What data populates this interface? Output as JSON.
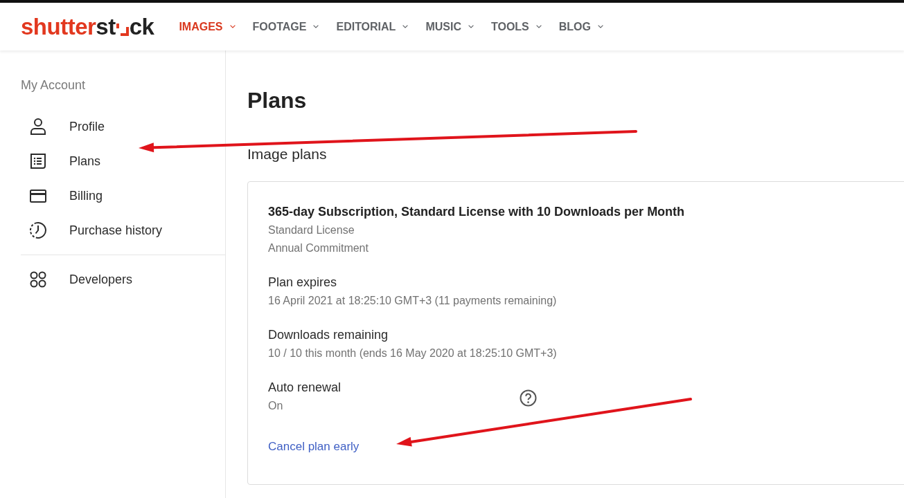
{
  "header": {
    "logo": [
      {
        "kind": "text",
        "text": "shutter",
        "color": "#e2381f"
      },
      {
        "kind": "text",
        "text": "st",
        "color": "#222222"
      },
      {
        "kind": "mark",
        "color": "#e2381f"
      },
      {
        "kind": "text",
        "text": "ck",
        "color": "#222222"
      }
    ],
    "nav": [
      {
        "label": "IMAGES",
        "selected": true
      },
      {
        "label": "FOOTAGE",
        "selected": false
      },
      {
        "label": "EDITORIAL",
        "selected": false
      },
      {
        "label": "MUSIC",
        "selected": false
      },
      {
        "label": "TOOLS",
        "selected": false
      },
      {
        "label": "BLOG",
        "selected": false
      }
    ]
  },
  "sidebar": {
    "heading": "My Account",
    "sections": [
      {
        "items": [
          {
            "label": "Profile"
          },
          {
            "label": "Plans"
          },
          {
            "label": "Billing"
          },
          {
            "label": "Purchase history"
          }
        ]
      },
      {
        "items": [
          {
            "label": "Developers"
          }
        ]
      }
    ]
  },
  "main": {
    "title": "Plans",
    "section_title": "Image plans",
    "plan": {
      "name": "365-day Subscription, Standard License with 10 Downloads per Month",
      "details": [
        "Standard License",
        "Annual Commitment"
      ],
      "fields": [
        {
          "label": "Plan expires",
          "value": "16 April 2021 at 18:25:10 GMT+3 (11 payments remaining)",
          "help": false
        },
        {
          "label": "Downloads remaining",
          "value": "10 / 10 this month (ends 16 May 2020 at 18:25:10 GMT+3)",
          "help": false
        },
        {
          "label": "Auto renewal",
          "value": "On",
          "help": true
        }
      ],
      "action": "Cancel plan early"
    }
  },
  "annotations": [
    {
      "kind": "arrow"
    },
    {
      "kind": "arrow"
    }
  ]
}
